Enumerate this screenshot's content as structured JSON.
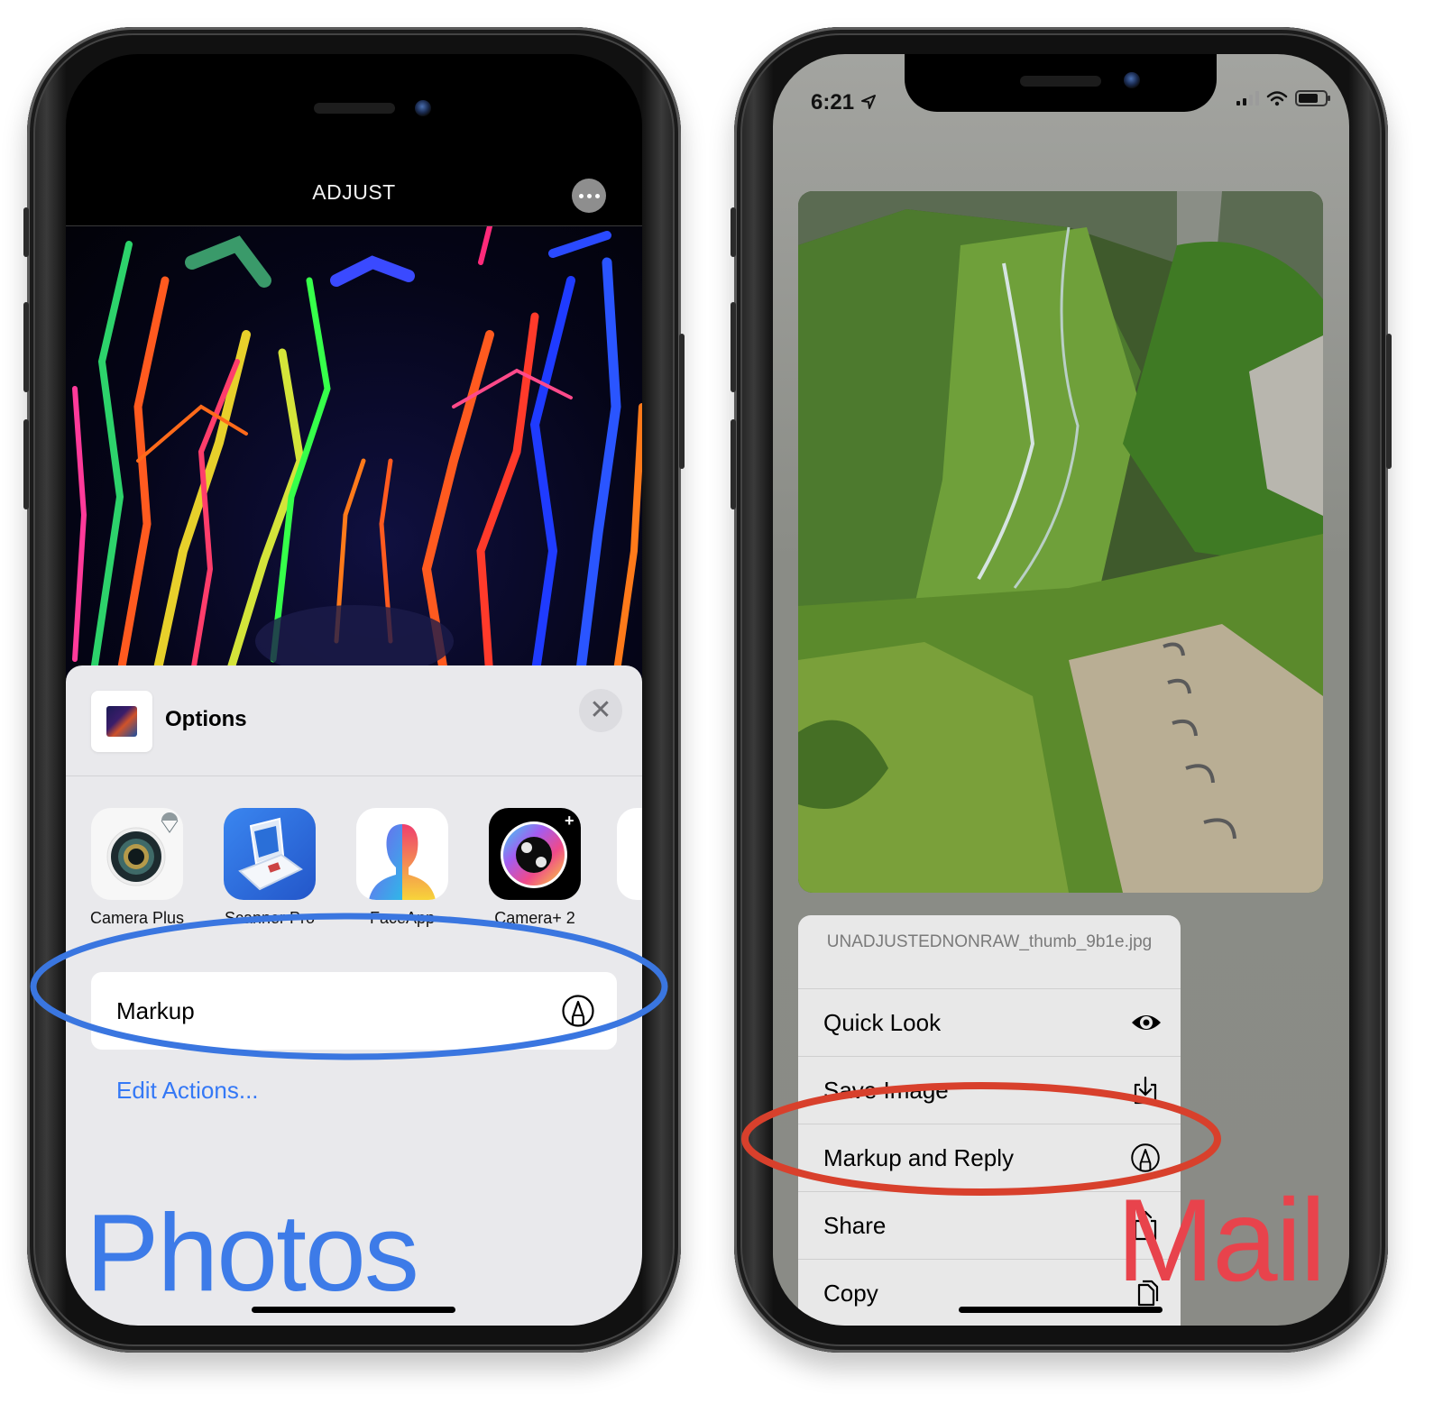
{
  "photos_screen": {
    "nav_title": "ADJUST",
    "more_button_icon": "ellipsis-icon",
    "options_sheet": {
      "title": "Options",
      "close_icon": "close-icon",
      "apps": [
        {
          "label": "Camera Plus",
          "icon": "camera-plus-app-icon"
        },
        {
          "label": "Scanner Pro",
          "icon": "scanner-pro-app-icon"
        },
        {
          "label": "FaceApp",
          "icon": "faceapp-app-icon"
        },
        {
          "label": "Camera+ 2",
          "icon": "camera-plus-2-app-icon"
        }
      ],
      "action": {
        "label": "Markup",
        "icon": "markup-pen-icon"
      },
      "edit_actions_link": "Edit Actions..."
    },
    "annotation_label": "Photos",
    "annotation_color": "#3d7be8"
  },
  "mail_screen": {
    "status_bar": {
      "time": "6:21",
      "location_icon": "location-arrow-icon",
      "signal_bars": 2,
      "signal_max": 4
    },
    "context_menu": {
      "filename": "UNADJUSTEDNONRAW_thumb_9b1e.jpg",
      "items": [
        {
          "label": "Quick Look",
          "icon": "eye-icon"
        },
        {
          "label": "Save Image",
          "icon": "save-download-icon"
        },
        {
          "label": "Markup and Reply",
          "icon": "markup-pen-icon"
        },
        {
          "label": "Share",
          "icon": "share-icon"
        },
        {
          "label": "Copy",
          "icon": "copy-icon"
        }
      ]
    },
    "annotation_label": "Mail",
    "annotation_color": "#e8434c"
  }
}
